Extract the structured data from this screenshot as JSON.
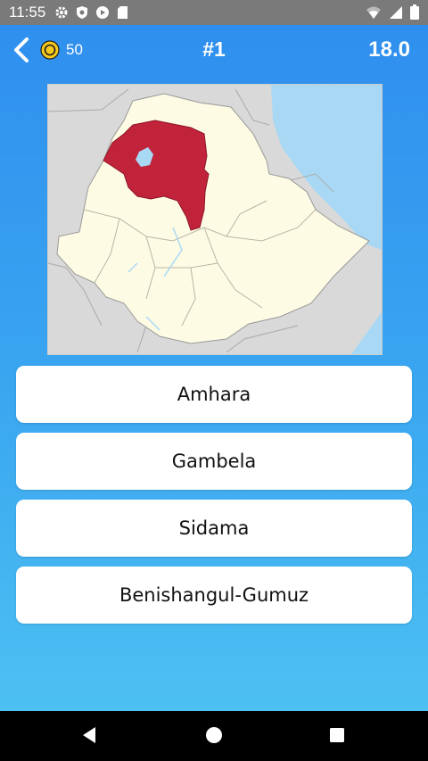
{
  "status_bar": {
    "time": "11:55",
    "icons": [
      "gear-icon",
      "shield-icon",
      "play-icon",
      "sdcard-icon",
      "wifi-icon",
      "signal-icon",
      "battery-icon"
    ]
  },
  "header": {
    "coin_count": "50",
    "question_number": "#1",
    "timer": "18.0"
  },
  "map": {
    "highlighted_region_color": "#c0233a",
    "land_color": "#fdfbe4",
    "water_color": "#a9d8f5",
    "neighbor_color": "#d9d9d9"
  },
  "answers": [
    {
      "label": "Amhara"
    },
    {
      "label": "Gambela"
    },
    {
      "label": "Sidama"
    },
    {
      "label": "Benishangul-Gumuz"
    }
  ],
  "nav": {
    "icons": [
      "back-triangle-icon",
      "home-circle-icon",
      "recents-square-icon"
    ]
  }
}
